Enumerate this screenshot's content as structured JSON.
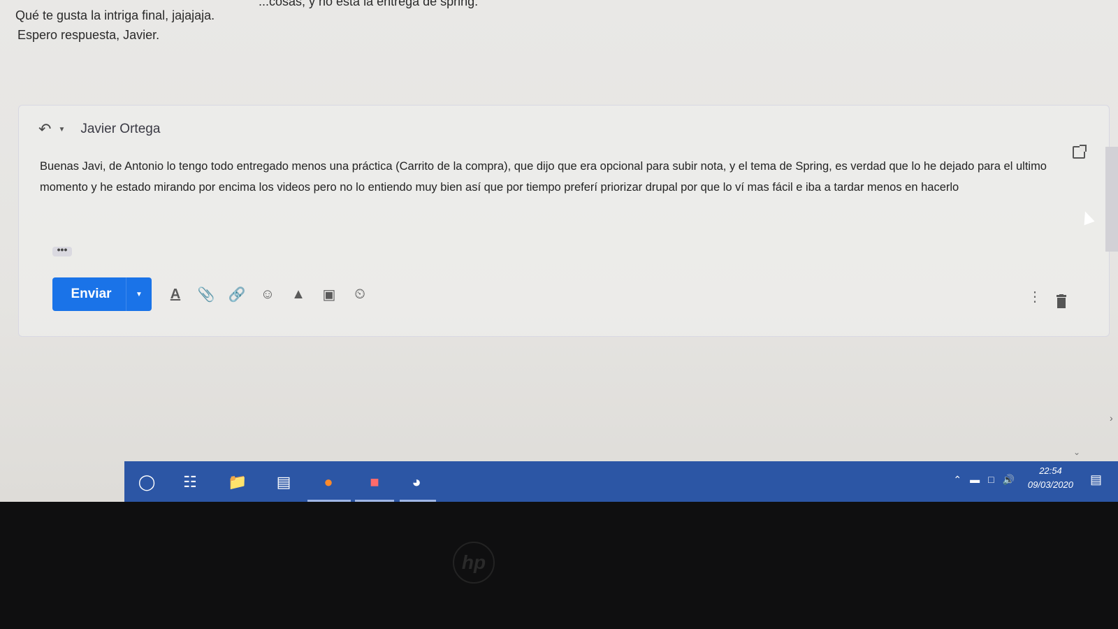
{
  "previous_message": {
    "line0": "...cosas, y no está la entrega de spring.",
    "line1": "Qué te gusta la intriga final, jajajaja.",
    "line2": "Espero respuesta, Javier."
  },
  "compose": {
    "recipient": "Javier Ortega",
    "body": "Buenas Javi, de Antonio lo tengo todo entregado menos una práctica (Carrito de la compra), que dijo que era opcional para subir nota, y el tema de Spring, es verdad que lo he dejado para el ultimo momento y he estado mirando por encima los videos pero no lo entiendo muy bien así que por tiempo preferí priorizar drupal por que lo ví mas fácil e iba a tardar menos en hacerlo",
    "ellipsis": "•••",
    "send_label": "Enviar"
  },
  "toolbar_icons": [
    "format-text-icon",
    "attach-icon",
    "link-icon",
    "emoji-icon",
    "drive-icon",
    "photo-icon",
    "confidential-icon"
  ],
  "taskbar": {
    "time": "22:54",
    "date": "09/03/2020"
  },
  "brand": {
    "accent": "#1a73e8",
    "taskbar": "#2c56a5"
  }
}
